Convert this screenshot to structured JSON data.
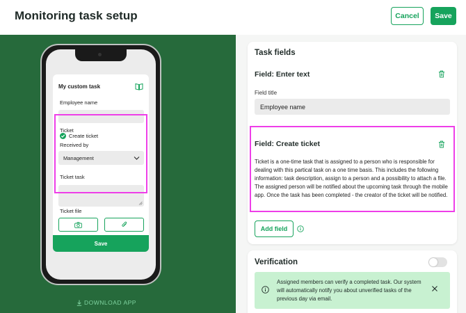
{
  "header": {
    "title": "Monitoring task setup",
    "cancel_label": "Cancel",
    "save_label": "Save"
  },
  "phone_preview": {
    "card_title": "My custom task",
    "field1_label": "Employee name",
    "ticket_label": "Ticket",
    "create_ticket_label": "Create ticket",
    "received_by_label": "Received by",
    "received_by_value": "Management",
    "ticket_task_label": "Ticket task",
    "ticket_file_label": "Ticket file",
    "save_label": "Save"
  },
  "download_app_label": "DOWNLOAD APP",
  "task_fields": {
    "title": "Task fields",
    "field_enter_text": {
      "heading": "Field: Enter text",
      "field_title_label": "Field title",
      "field_title_value": "Employee name"
    },
    "field_create_ticket": {
      "heading": "Field: Create ticket",
      "description": "Ticket is a one-time task that is assigned to a person who is responsible for dealing with this partical task on a one time basis. This includes the following information: task description, assign to a person and a possibility to attach a file. The assigned person will be notified about the upcoming task through the mobile app. Once the task has been completed - the creator of the ticket will be notified."
    },
    "add_field_label": "Add field"
  },
  "verification": {
    "title": "Verification",
    "enabled": false,
    "notice": "Assigned members can verify a completed task. Our system will automatically notify you about unverified tasks of the previous day via email."
  },
  "colors": {
    "accent": "#16a35c",
    "left_panel": "#266a3b",
    "highlight": "#ee3ee8",
    "notice_bg": "#c8f1d1"
  },
  "icons": [
    "book-icon",
    "check-circle-icon",
    "chevron-down-icon",
    "camera-icon",
    "paperclip-icon",
    "trash-icon",
    "info-icon",
    "close-icon",
    "download-icon"
  ]
}
